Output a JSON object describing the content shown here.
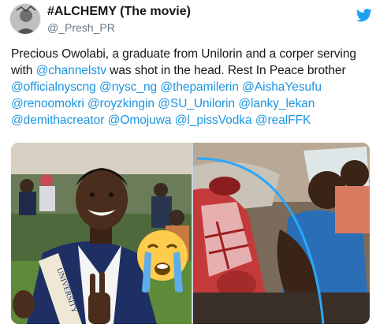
{
  "tweet": {
    "display_name": "#ALCHEMY (The movie)",
    "handle": "@_Presh_PR",
    "text_intro": "Precious Owolabi, a graduate from Unilorin and a corper serving with ",
    "mention_channelstv": "@channelstv",
    "text_after": " was shot in the head. Rest In Peace brother",
    "mentions": [
      "@officialnyscng",
      "@nysc_ng",
      "@thepamilerin",
      "@AishaYesufu",
      "@renoomokri",
      "@royzkingin",
      "@SU_Unilorin",
      "@lanky_lekan",
      "@demithacreator",
      "@Omojuwa",
      "@l_pissVodka",
      "@realFFK"
    ],
    "sash_text": "UNIVERSITY"
  },
  "icons": {
    "brand": "twitter-bird-icon",
    "emoji": "loudly-crying-face-emoji"
  },
  "colors": {
    "twitter_blue": "#1da1f2",
    "mention_blue": "#1b95e0",
    "text": "#14171a",
    "secondary": "#657786"
  }
}
